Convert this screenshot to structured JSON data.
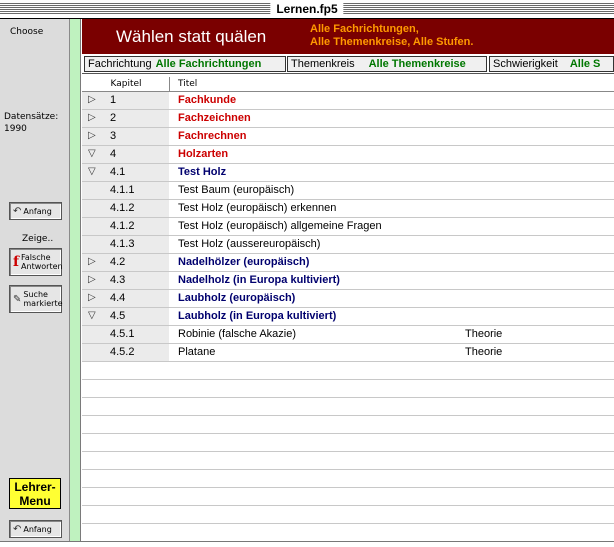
{
  "window": {
    "title": "Lernen.fp5"
  },
  "sidebar": {
    "choose_label": "Choose",
    "records_label": "Datensätze:",
    "records_count": "1990",
    "anfang_top": "Anfang",
    "zeige_label": "Zeige..",
    "falsche_line1": "Falsche",
    "falsche_line2": "Antworten",
    "suche_line1": "Suche",
    "suche_line2": "markierte",
    "lehrer_line1": "Lehrer-",
    "lehrer_line2": "Menu",
    "anfang_bottom": "Anfang"
  },
  "header": {
    "slogan": "Wählen statt quälen",
    "info_line1": "Alle Fachrichtungen,",
    "info_line2": "Alle Themenkreise,  Alle Stufen."
  },
  "filters": {
    "fachrichtung_label": "Fachrichtung",
    "fachrichtung_value": "Alle Fachrichtungen",
    "themenkreis_label": "Themenkreis",
    "themenkreis_value": "Alle Themenkreise",
    "schwierigkeit_label": "Schwierigkeit",
    "schwierigkeit_value": "Alle S"
  },
  "columns": {
    "kapitel": "Kapitel",
    "titel": "Titel"
  },
  "rows": [
    {
      "kapitel": "1",
      "titel": "Fachkunde",
      "extra": ""
    },
    {
      "kapitel": "2",
      "titel": "Fachzeichnen",
      "extra": ""
    },
    {
      "kapitel": "3",
      "titel": "Fachrechnen",
      "extra": ""
    },
    {
      "kapitel": "4",
      "titel": "Holzarten",
      "extra": ""
    },
    {
      "kapitel": "4.1",
      "titel": "Test Holz",
      "extra": ""
    },
    {
      "kapitel": "4.1.1",
      "titel": "Test Baum (europäisch)",
      "extra": ""
    },
    {
      "kapitel": "4.1.2",
      "titel": "Test Holz (europäisch) erkennen",
      "extra": ""
    },
    {
      "kapitel": "4.1.2",
      "titel": "Test Holz (europäisch) allgemeine Fragen",
      "extra": ""
    },
    {
      "kapitel": "4.1.3",
      "titel": "Test Holz (aussereuropäisch)",
      "extra": ""
    },
    {
      "kapitel": "4.2",
      "titel": "Nadelhölzer (europäisch)",
      "extra": ""
    },
    {
      "kapitel": "4.3",
      "titel": "Nadelholz (in Europa kultiviert)",
      "extra": ""
    },
    {
      "kapitel": "4.4",
      "titel": "Laubholz (europäisch)",
      "extra": ""
    },
    {
      "kapitel": "4.5",
      "titel": "Laubholz (in Europa kultiviert)",
      "extra": ""
    },
    {
      "kapitel": "4.5.1",
      "titel": "Robinie (falsche Akazie)",
      "extra": "Theorie"
    },
    {
      "kapitel": "4.5.2",
      "titel": "Platane",
      "extra": "Theorie"
    }
  ],
  "colors": {
    "header_bg": "#7a0000",
    "accent_orange": "#ff9900",
    "green": "#007700",
    "red": "#cc0000",
    "navy": "#00006e",
    "teacher_yellow": "#ffff33"
  }
}
